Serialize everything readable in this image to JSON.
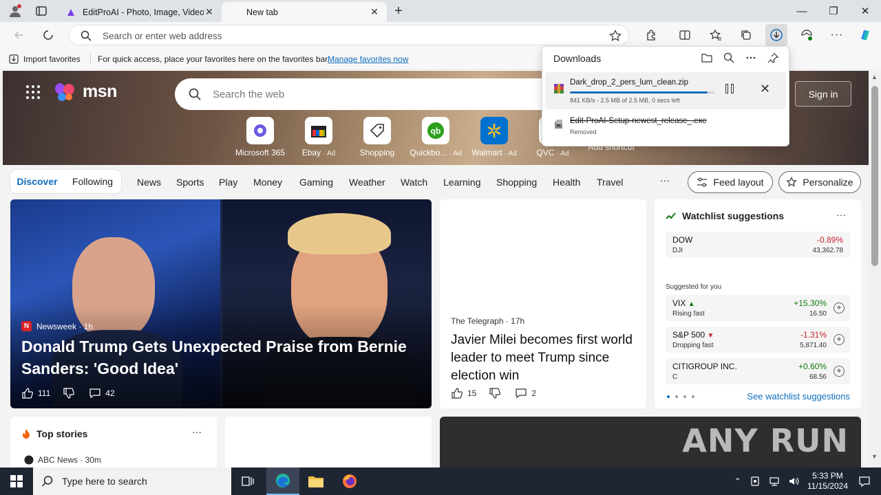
{
  "browser": {
    "tabs": [
      {
        "label": "EditProAI - Photo, Image, Video E",
        "active": false
      },
      {
        "label": "New tab",
        "active": true
      }
    ],
    "address_placeholder": "Search or enter web address",
    "favorites_bar": {
      "import_label": "Import favorites",
      "hint": "For quick access, place your favorites here on the favorites bar.",
      "manage_link": "Manage favorites now"
    }
  },
  "downloads": {
    "title": "Downloads",
    "items": [
      {
        "filename": "Dark_drop_2_pers_lum_clean.zip",
        "status": "841 KB/s - 2.5 MB of 2.5 MB, 0 secs left",
        "progress": 0.95
      },
      {
        "filename": "Edit-ProAI-Setup-newest_release_.exe",
        "status": "Removed"
      }
    ]
  },
  "msn": {
    "logo": "msn",
    "search_placeholder": "Search the web",
    "sign_in": "Sign in",
    "shortcuts": [
      {
        "label": "Microsoft 365",
        "ad": ""
      },
      {
        "label": "Ebay",
        "ad": "· Ad"
      },
      {
        "label": "Shopping",
        "ad": ""
      },
      {
        "label": "Quickbo...",
        "ad": "· Ad"
      },
      {
        "label": "Walmart",
        "ad": "· Ad"
      },
      {
        "label": "QVC",
        "ad": "· Ad"
      },
      {
        "label": "Add shortcut",
        "ad": ""
      }
    ],
    "nav": {
      "discover": "Discover",
      "following": "Following",
      "links": [
        "News",
        "Sports",
        "Play",
        "Money",
        "Gaming",
        "Weather",
        "Watch",
        "Learning",
        "Shopping",
        "Health",
        "Travel"
      ],
      "more": "···",
      "feed_layout": "Feed layout",
      "personalize": "Personalize"
    },
    "main_story": {
      "source": "Newsweek · 1h",
      "source_badge": "N",
      "headline": "Donald Trump Gets Unexpected Praise from Bernie Sanders: 'Good Idea'",
      "likes": "111",
      "comments": "42"
    },
    "side_story": {
      "source": "The Telegraph · 17h",
      "headline": "Javier Milei becomes first world leader to meet Trump since election win",
      "likes": "15",
      "comments": "2"
    },
    "watchlist": {
      "title": "Watchlist suggestions",
      "more": "···",
      "index": {
        "name": "DOW",
        "symbol": "DJI",
        "change": "-0.89%",
        "price": "43,362.78"
      },
      "suggested_label": "Suggested for you",
      "suggested": [
        {
          "name": "VIX",
          "status": "Rising fast",
          "change": "+15.30%",
          "price": "16.50"
        },
        {
          "name": "S&P 500",
          "status": "Dropping fast",
          "change": "-1.31%",
          "price": "5,871.40"
        },
        {
          "name": "CITIGROUP INC.",
          "status": "C",
          "change": "+0.60%",
          "price": "68.56"
        }
      ],
      "see_more": "See watchlist suggestions"
    },
    "top_stories": {
      "title": "Top stories",
      "more": "···",
      "first_source": "ABC News · 30m"
    },
    "watermark": "ANY RUN"
  },
  "taskbar": {
    "search_placeholder": "Type here to search",
    "time": "5:33 PM",
    "date": "11/15/2024"
  },
  "colors": {
    "accent": "#0f6cbd",
    "negative": "#c4262e",
    "positive": "#107c10"
  }
}
